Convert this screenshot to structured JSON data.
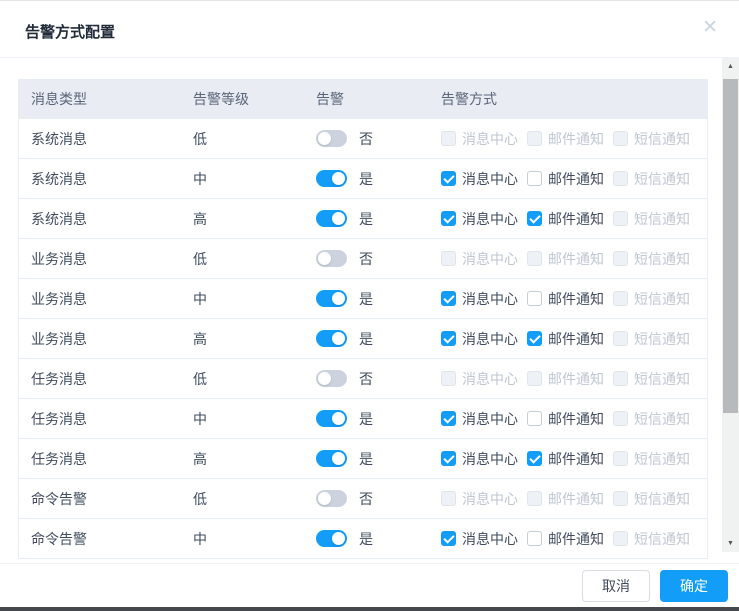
{
  "dialog": {
    "title": "告警方式配置"
  },
  "icons": {
    "close": "✕",
    "scroll_up": "▲",
    "scroll_down": "▼"
  },
  "table": {
    "headers": [
      "消息类型",
      "告警等级",
      "告警",
      "告警方式"
    ],
    "rows": [
      {
        "type": "系统消息",
        "level": "低",
        "alert_on": false,
        "alert_label": "否",
        "methods": [
          {
            "label": "消息中心",
            "checked": false,
            "disabled": true
          },
          {
            "label": "邮件通知",
            "checked": false,
            "disabled": true
          },
          {
            "label": "短信通知",
            "checked": false,
            "disabled": true
          }
        ]
      },
      {
        "type": "系统消息",
        "level": "中",
        "alert_on": true,
        "alert_label": "是",
        "methods": [
          {
            "label": "消息中心",
            "checked": true,
            "disabled": false
          },
          {
            "label": "邮件通知",
            "checked": false,
            "disabled": false
          },
          {
            "label": "短信通知",
            "checked": false,
            "disabled": true
          }
        ]
      },
      {
        "type": "系统消息",
        "level": "高",
        "alert_on": true,
        "alert_label": "是",
        "methods": [
          {
            "label": "消息中心",
            "checked": true,
            "disabled": false
          },
          {
            "label": "邮件通知",
            "checked": true,
            "disabled": false
          },
          {
            "label": "短信通知",
            "checked": false,
            "disabled": true
          }
        ]
      },
      {
        "type": "业务消息",
        "level": "低",
        "alert_on": false,
        "alert_label": "否",
        "methods": [
          {
            "label": "消息中心",
            "checked": false,
            "disabled": true
          },
          {
            "label": "邮件通知",
            "checked": false,
            "disabled": true
          },
          {
            "label": "短信通知",
            "checked": false,
            "disabled": true
          }
        ]
      },
      {
        "type": "业务消息",
        "level": "中",
        "alert_on": true,
        "alert_label": "是",
        "methods": [
          {
            "label": "消息中心",
            "checked": true,
            "disabled": false
          },
          {
            "label": "邮件通知",
            "checked": false,
            "disabled": false
          },
          {
            "label": "短信通知",
            "checked": false,
            "disabled": true
          }
        ]
      },
      {
        "type": "业务消息",
        "level": "高",
        "alert_on": true,
        "alert_label": "是",
        "methods": [
          {
            "label": "消息中心",
            "checked": true,
            "disabled": false
          },
          {
            "label": "邮件通知",
            "checked": true,
            "disabled": false
          },
          {
            "label": "短信通知",
            "checked": false,
            "disabled": true
          }
        ]
      },
      {
        "type": "任务消息",
        "level": "低",
        "alert_on": false,
        "alert_label": "否",
        "methods": [
          {
            "label": "消息中心",
            "checked": false,
            "disabled": true
          },
          {
            "label": "邮件通知",
            "checked": false,
            "disabled": true
          },
          {
            "label": "短信通知",
            "checked": false,
            "disabled": true
          }
        ]
      },
      {
        "type": "任务消息",
        "level": "中",
        "alert_on": true,
        "alert_label": "是",
        "methods": [
          {
            "label": "消息中心",
            "checked": true,
            "disabled": false
          },
          {
            "label": "邮件通知",
            "checked": false,
            "disabled": false
          },
          {
            "label": "短信通知",
            "checked": false,
            "disabled": true
          }
        ]
      },
      {
        "type": "任务消息",
        "level": "高",
        "alert_on": true,
        "alert_label": "是",
        "methods": [
          {
            "label": "消息中心",
            "checked": true,
            "disabled": false
          },
          {
            "label": "邮件通知",
            "checked": true,
            "disabled": false
          },
          {
            "label": "短信通知",
            "checked": false,
            "disabled": true
          }
        ]
      },
      {
        "type": "命令告警",
        "level": "低",
        "alert_on": false,
        "alert_label": "否",
        "methods": [
          {
            "label": "消息中心",
            "checked": false,
            "disabled": true
          },
          {
            "label": "邮件通知",
            "checked": false,
            "disabled": true
          },
          {
            "label": "短信通知",
            "checked": false,
            "disabled": true
          }
        ]
      },
      {
        "type": "命令告警",
        "level": "中",
        "alert_on": true,
        "alert_label": "是",
        "methods": [
          {
            "label": "消息中心",
            "checked": true,
            "disabled": false
          },
          {
            "label": "邮件通知",
            "checked": false,
            "disabled": false
          },
          {
            "label": "短信通知",
            "checked": false,
            "disabled": true
          }
        ]
      }
    ]
  },
  "footer": {
    "cancel_label": "取消",
    "confirm_label": "确定"
  },
  "colors": {
    "accent": "#119df8",
    "header_bg": "#e9ecf3",
    "header_text": "#5a6578",
    "body_text": "#414c5e",
    "disabled_text": "#bfc7d3",
    "toggle_off": "#ccd3de"
  }
}
